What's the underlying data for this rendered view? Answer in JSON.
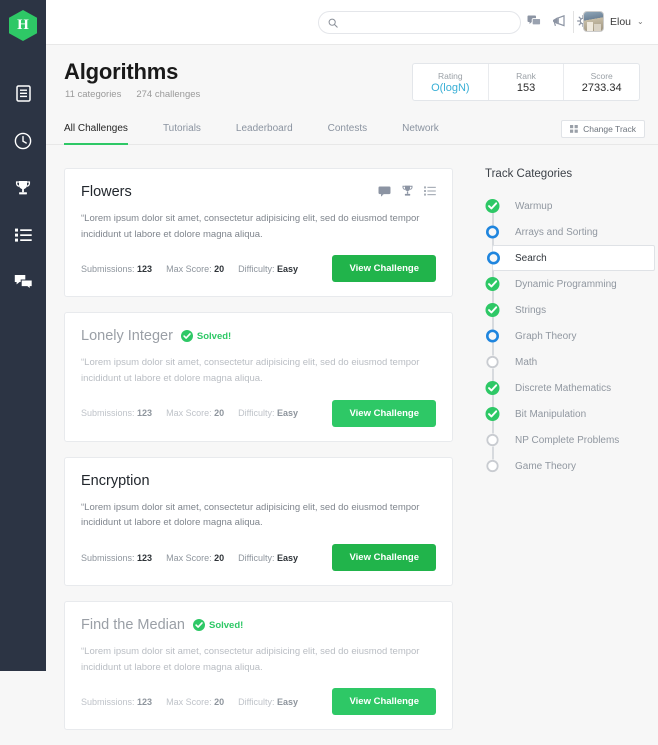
{
  "brand": {
    "logo_letter": "H",
    "logo_color": "#2ec866"
  },
  "topbar": {
    "search_placeholder": "",
    "search_value": "",
    "icons": [
      {
        "name": "chat-icon",
        "label": "Chat"
      },
      {
        "name": "megaphone-icon",
        "label": "Announcements"
      },
      {
        "name": "gear-icon",
        "label": "Settings"
      }
    ],
    "user_name": "Elou",
    "chevron": "⌄"
  },
  "rail": {
    "items": [
      {
        "name": "sidebar-item-dashboard",
        "icon": "document-icon"
      },
      {
        "name": "sidebar-item-recent",
        "icon": "clock-icon"
      },
      {
        "name": "sidebar-item-leaderboard",
        "icon": "trophy-icon"
      },
      {
        "name": "sidebar-item-tracks",
        "icon": "list-icon"
      },
      {
        "name": "sidebar-item-discussions",
        "icon": "chat-bubbles-icon"
      }
    ]
  },
  "header": {
    "title": "Algorithms",
    "categories_count": "11 categories",
    "challenges_count": "274 challenges",
    "stats": [
      {
        "label": "Rating",
        "value": "O(logN)",
        "accent": true
      },
      {
        "label": "Rank",
        "value": "153",
        "accent": false
      },
      {
        "label": "Score",
        "value": "2733.34",
        "accent": false
      }
    ],
    "accent_color": "#39afd6"
  },
  "tabs": {
    "items": [
      {
        "label": "All Challenges",
        "active": true
      },
      {
        "label": "Tutorials",
        "active": false
      },
      {
        "label": "Leaderboard",
        "active": false
      },
      {
        "label": "Contests",
        "active": false
      },
      {
        "label": "Network",
        "active": false
      }
    ],
    "active_color": "#2ec866",
    "change_track_label": "Change Track"
  },
  "challenges": {
    "meta_labels": {
      "submissions": "Submissions:",
      "max_score": "Max Score:",
      "difficulty": "Difficulty:"
    },
    "view_button_label": "View Challenge",
    "solved_label": "Solved!",
    "items": [
      {
        "title": "Flowers",
        "solved": false,
        "has_icons": true,
        "description": "“Lorem ipsum dolor sit amet, consectetur adipisicing elit, sed do eiusmod tempor incididunt ut labore et dolore magna aliqua.",
        "submissions": "123",
        "max_score": "20",
        "difficulty": "Easy"
      },
      {
        "title": "Lonely Integer",
        "solved": true,
        "has_icons": false,
        "description": "“Lorem ipsum dolor sit amet, consectetur adipisicing elit, sed do eiusmod tempor incididunt ut labore et dolore magna aliqua.",
        "submissions": "123",
        "max_score": "20",
        "difficulty": "Easy"
      },
      {
        "title": "Encryption",
        "solved": false,
        "has_icons": false,
        "description": "“Lorem ipsum dolor sit amet, consectetur adipisicing elit, sed do eiusmod tempor incididunt ut labore et dolore magna aliqua.",
        "submissions": "123",
        "max_score": "20",
        "difficulty": "Easy"
      },
      {
        "title": "Find the Median",
        "solved": true,
        "has_icons": false,
        "description": "“Lorem ipsum dolor sit amet, consectetur adipisicing elit, sed do eiusmod tempor incididunt ut labore et dolore magna aliqua.",
        "submissions": "123",
        "max_score": "20",
        "difficulty": "Easy"
      }
    ]
  },
  "track": {
    "heading": "Track Categories",
    "completed_color": "#2ec866",
    "inprogress_color": "#1f85de",
    "pending_color": "#c9ccd1",
    "items": [
      {
        "label": "Warmup",
        "status": "completed",
        "current": false
      },
      {
        "label": "Arrays and Sorting",
        "status": "inprogress",
        "current": false
      },
      {
        "label": "Search",
        "status": "inprogress",
        "current": true
      },
      {
        "label": "Dynamic Programming",
        "status": "completed",
        "current": false
      },
      {
        "label": "Strings",
        "status": "completed",
        "current": false
      },
      {
        "label": "Graph Theory",
        "status": "inprogress",
        "current": false
      },
      {
        "label": "Math",
        "status": "pending",
        "current": false
      },
      {
        "label": "Discrete Mathematics",
        "status": "completed",
        "current": false
      },
      {
        "label": "Bit Manipulation",
        "status": "completed",
        "current": false
      },
      {
        "label": "NP Complete Problems",
        "status": "pending",
        "current": false
      },
      {
        "label": "Game Theory",
        "status": "pending",
        "current": false
      }
    ]
  }
}
